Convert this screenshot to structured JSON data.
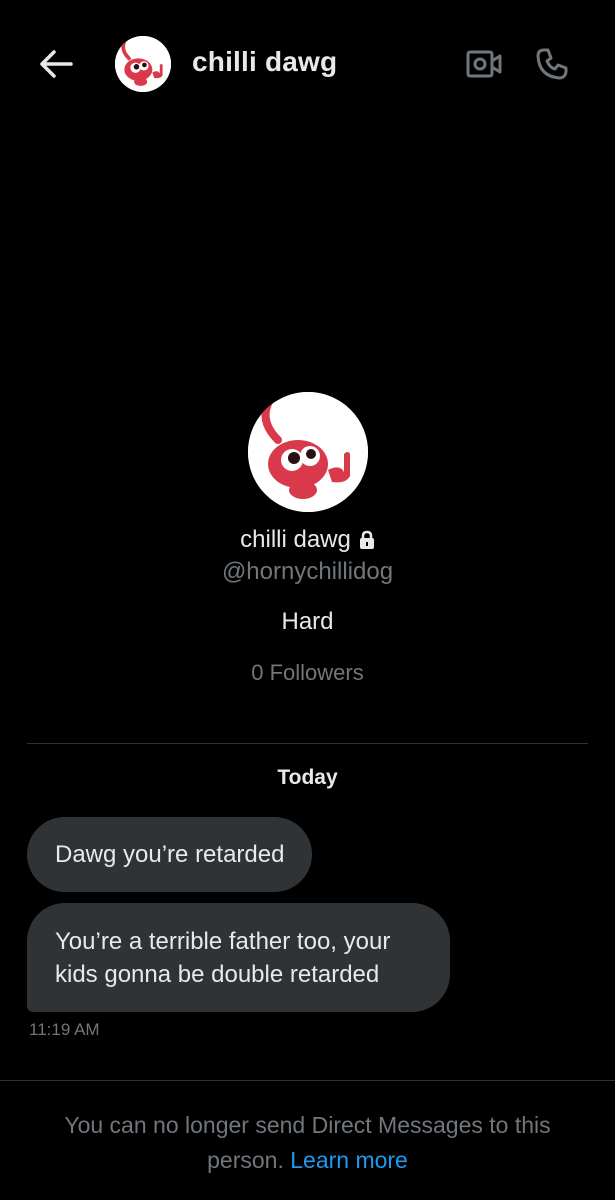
{
  "header": {
    "title": "chilli dawg",
    "back_icon": "arrow-left-icon",
    "video_icon": "video-camera-icon",
    "call_icon": "phone-icon"
  },
  "profile": {
    "name": "chilli dawg",
    "lock_icon": "lock-icon",
    "handle": "@hornychillidog",
    "bio": "Hard",
    "followers": "0 Followers"
  },
  "conversation": {
    "date_label": "Today",
    "messages": [
      {
        "text": "Dawg you’re retarded"
      },
      {
        "text": "You’re a terrible father too, your kids gonna be double retarded"
      }
    ],
    "timestamp": "11:19 AM"
  },
  "footer": {
    "notice": "You can no longer send Direct Messages to this person.",
    "link_label": "Learn more"
  },
  "colors": {
    "background": "#000000",
    "bubble": "#2f3336",
    "muted_text": "#71767b",
    "link": "#1d9bf0",
    "avatar_red": "#d9394a"
  }
}
